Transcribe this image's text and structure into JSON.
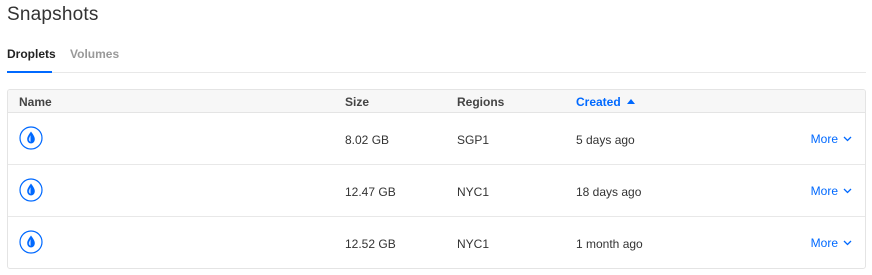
{
  "page": {
    "title": "Snapshots"
  },
  "tabs": [
    {
      "label": "Droplets",
      "active": true
    },
    {
      "label": "Volumes",
      "active": false
    }
  ],
  "table": {
    "headers": {
      "name": "Name",
      "size": "Size",
      "regions": "Regions",
      "created": "Created"
    },
    "sort": {
      "column": "created",
      "direction": "ascending"
    },
    "rows": [
      {
        "icon": "droplet-icon",
        "size": "8.02 GB",
        "region": "SGP1",
        "created": "5 days ago",
        "action": "More"
      },
      {
        "icon": "droplet-icon",
        "size": "12.47 GB",
        "region": "NYC1",
        "created": "18 days ago",
        "action": "More"
      },
      {
        "icon": "droplet-icon",
        "size": "12.52 GB",
        "region": "NYC1",
        "created": "1 month ago",
        "action": "More"
      }
    ]
  },
  "colors": {
    "accent": "#0069ff",
    "text": "#333333",
    "muted": "#999999",
    "header_bg": "#f7f7f7",
    "border": "#e4e4e4"
  }
}
